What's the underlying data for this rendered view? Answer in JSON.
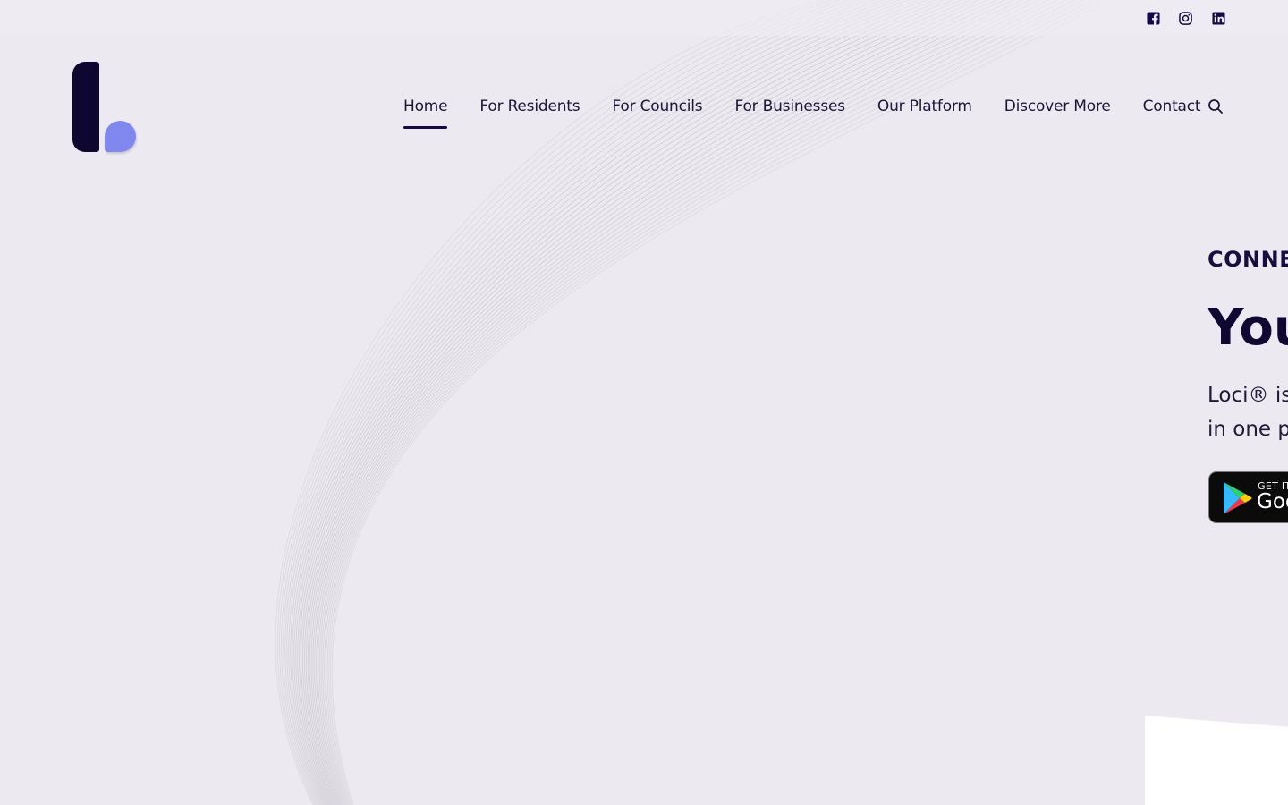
{
  "social": [
    {
      "name": "facebook-icon"
    },
    {
      "name": "instagram-icon"
    },
    {
      "name": "linkedin-icon"
    }
  ],
  "nav": {
    "items": [
      "Home",
      "For Residents",
      "For Councils",
      "For Businesses",
      "Our Platform",
      "Discover More",
      "Contact"
    ],
    "active": "Home"
  },
  "hero": {
    "kicker": "CONNE",
    "title": "You",
    "desc_line1": "Loci® is t",
    "desc_line2": "in one pl"
  },
  "badge": {
    "small": "GET IT",
    "big": "Goo"
  },
  "colors": {
    "background": "#ece9f0",
    "brand_dark": "#0e0730",
    "brand_accent": "#8088f0"
  }
}
